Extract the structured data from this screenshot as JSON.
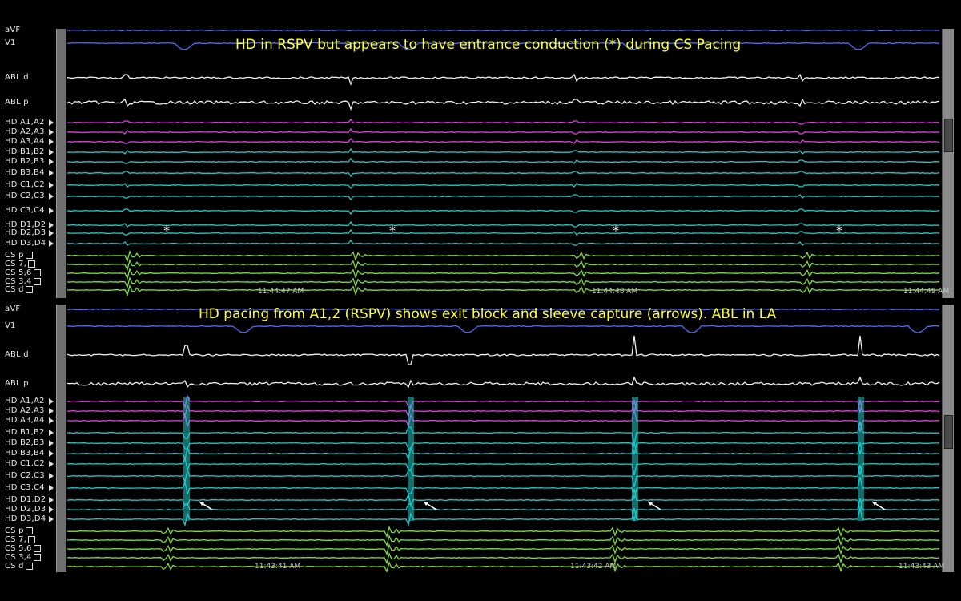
{
  "panels": [
    {
      "caption": "HD in RSPV but appears to have entrance conduction (*) during CS Pacing",
      "channels": [
        "aVF",
        "V1",
        "ABL d",
        "ABL p",
        "HD A1,A2",
        "HD A2,A3",
        "HD A3,A4",
        "HD B1,B2",
        "HD B2,B3",
        "HD B3,B4",
        "HD C1,C2",
        "HD C2,C3",
        "HD C3,C4",
        "HD D1,D2",
        "HD D2,D3",
        "HD D3,D4",
        "CS p",
        "CS 7,",
        "CS 5,6",
        "CS 3,4",
        "CS d"
      ],
      "timestamps": [
        "11:44:47 AM",
        "11:44:48 AM",
        "11:44:49 AM"
      ],
      "annotations": [
        "*",
        "*",
        "*",
        "*"
      ]
    },
    {
      "caption": "HD pacing from A1,2 (RSPV) shows exit block and sleeve capture (arrows). ABL in LA",
      "channels": [
        "aVF",
        "V1",
        "ABL d",
        "ABL p",
        "HD A1,A2",
        "HD A2,A3",
        "HD A3,A4",
        "HD B1,B2",
        "HD B2,B3",
        "HD B3,B4",
        "HD C1,C2",
        "HD C2,C3",
        "HD C3,C4",
        "HD D1,D2",
        "HD D2,D3",
        "HD D3,D4",
        "CS p",
        "CS 7,",
        "CS 5,6",
        "CS 3,4",
        "CS d"
      ],
      "timestamps": [
        "11:43:41 AM",
        "11:43:42 AM",
        "11:43:43 AM"
      ]
    }
  ],
  "colors": {
    "surface": "#4a6cff",
    "abl": "#f0f0f0",
    "hd_a": "#e040e0",
    "hd_other": "#22c8c8",
    "cs": "#7ee03a",
    "caption": "#ffff33",
    "annotation": "#ffffff"
  }
}
